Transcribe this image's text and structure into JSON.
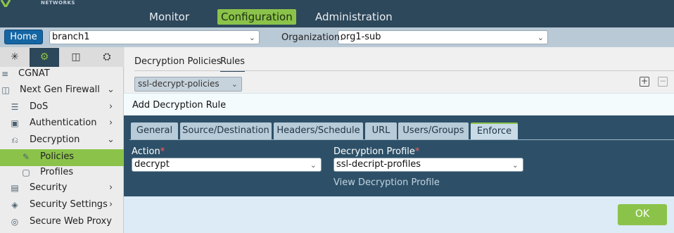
{
  "brand": {
    "sub_text": "NETWORKS"
  },
  "top_nav": [
    {
      "label": "Monitor"
    },
    {
      "label": "Configuration"
    },
    {
      "label": "Administration"
    }
  ],
  "home_bar": {
    "home_label": "Home",
    "appliance_value": "branch1",
    "org_label": "Organization:",
    "org_value": "org1-sub"
  },
  "sidebar": {
    "tab_icons": [
      "network-icon",
      "gear-icon",
      "cube-icon",
      "settings-shield-icon"
    ],
    "items": [
      {
        "label": "CGNAT",
        "icon": "cgnat-icon"
      },
      {
        "label": "Next Gen Firewall",
        "icon": "firewall-icon"
      },
      {
        "label": "DoS",
        "icon": "dos-icon"
      },
      {
        "label": "Authentication",
        "icon": "authentication-icon"
      },
      {
        "label": "Decryption",
        "icon": "lock-icon"
      },
      {
        "label": "Policies",
        "icon": "policy-icon"
      },
      {
        "label": "Profiles",
        "icon": "profile-icon"
      },
      {
        "label": "Security",
        "icon": "security-icon"
      },
      {
        "label": "Security Settings",
        "icon": "shield-icon"
      },
      {
        "label": "Secure Web Proxy",
        "icon": "globe-icon"
      }
    ]
  },
  "main": {
    "tabs": [
      {
        "label": "Decryption Policies"
      },
      {
        "label": "Rules"
      }
    ],
    "policy_select_value": "ssl-decrypt-policies"
  },
  "modal": {
    "title": "Add Decryption Rule",
    "tabs": [
      {
        "label": "General"
      },
      {
        "label": "Source/Destination"
      },
      {
        "label": "Headers/Schedule"
      },
      {
        "label": "URL"
      },
      {
        "label": "Users/Groups"
      },
      {
        "label": "Enforce"
      }
    ],
    "action_label": "Action",
    "action_value": "decrypt",
    "profile_label": "Decryption Profile",
    "profile_value": "ssl-decript-profiles",
    "view_profile_link": "View Decryption Profile",
    "required_marker": "*",
    "ok_label": "OK"
  },
  "colors": {
    "accent": "#8bc34a",
    "nav_bg": "#2d475b",
    "home_btn": "#1565a3",
    "modal_body": "#2d5068"
  }
}
